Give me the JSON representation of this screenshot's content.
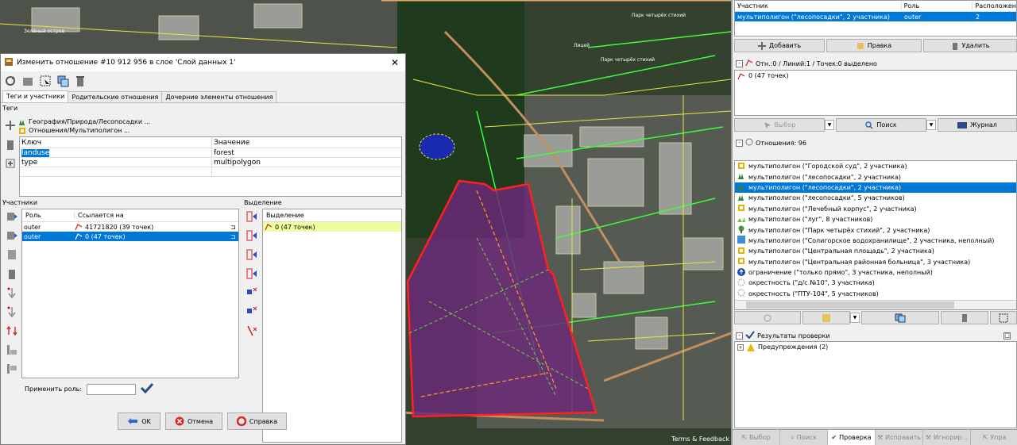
{
  "map": {
    "credit": "Terms & Feedback",
    "labels": [
      "Зелёный остров",
      "Парк четырёх стихий",
      "Лицей",
      "Парк четырёх стихий"
    ]
  },
  "dialog": {
    "title": "Изменить отношение #10 912 956 в слое 'Слой данных 1'",
    "close": "✕",
    "tabs": [
      "Теги и участники",
      "Родительские отношения",
      "Дочерние элементы отношения"
    ],
    "tags_label": "Теги",
    "presets": [
      "География/Природа/Лесопосадки ...",
      "Отношения/Мультиполигон ..."
    ],
    "tag_headers": {
      "key": "Ключ",
      "value": "Значение"
    },
    "tags": [
      {
        "key": "landuse",
        "value": "forest"
      },
      {
        "key": "type",
        "value": "multipolygon"
      }
    ],
    "members_label": "Участники",
    "member_headers": {
      "role": "Роль",
      "ref": "Ссылается на"
    },
    "members": [
      {
        "role": "outer",
        "ref": "41721820 (39 точек)"
      },
      {
        "role": "outer",
        "ref": "0 (47 точек)"
      }
    ],
    "selection_label": "Выделение",
    "selection_header": "Выделение",
    "selection_items": [
      "0 (47 точек)"
    ],
    "apply_role_label": "Применить роль:",
    "apply_role_value": "",
    "buttons": {
      "ok": "OK",
      "cancel": "Отмена",
      "help": "Справка"
    }
  },
  "members_panel": {
    "headers": {
      "member": "Участник",
      "role": "Роль",
      "position": "Расположен"
    },
    "rows": [
      {
        "member": "мультиполигон (\"лесопосадки\", 2 участника)",
        "role": "outer",
        "position": "2"
      }
    ],
    "buttons": {
      "add": "Добавить",
      "edit": "Правка",
      "delete": "Удалить"
    }
  },
  "selection_panel": {
    "title": "Отн.:0 / Линий:1 / Точек:0 выделено",
    "items": [
      "0 (47 точек)"
    ],
    "buttons": {
      "select": "Выбор",
      "search": "Поиск",
      "journal": "Журнал"
    }
  },
  "relations_panel": {
    "title": "Отношения: 96",
    "items": [
      "мультиполигон (\"Городской суд\", 2 участника)",
      "мультиполигон (\"лесопосадки\", 2 участника)",
      "мультиполигон (\"лесопосадки\", 2 участника)",
      "мультиполигон (\"лесопосадки\", 5 участников)",
      "мультиполигон (\"Лечебный корпус\", 2 участника)",
      "мультиполигон (\"луг\", 8 участников)",
      "мультиполигон (\"Парк четырёх стихий\", 2 участника)",
      "мультиполигон (\"Солигорское водохранилище\", 2 участника, неполный)",
      "мультиполигон (\"Центральная площадь\", 2 участника)",
      "мультиполигон (\"Центральная районная больница\", 3 участника)",
      "ограничение (\"только прямо\", 3 участника, неполный)",
      "окрестность (\"д/с №10\", 3 участника)",
      "окрестность (\"ПТУ-104\", 5 участников)"
    ],
    "selected_index": 2
  },
  "validation_panel": {
    "title": "Результаты проверки",
    "warnings": "Предупреждения (2)"
  },
  "bottom_tabs": [
    "Выбор",
    "Поиск",
    "Проверка",
    "Исправить",
    "Игнорир...",
    "Упра"
  ],
  "colors": {
    "accent": "#0078d7",
    "forest": "#6b2a78",
    "outline": "#ff2020"
  }
}
